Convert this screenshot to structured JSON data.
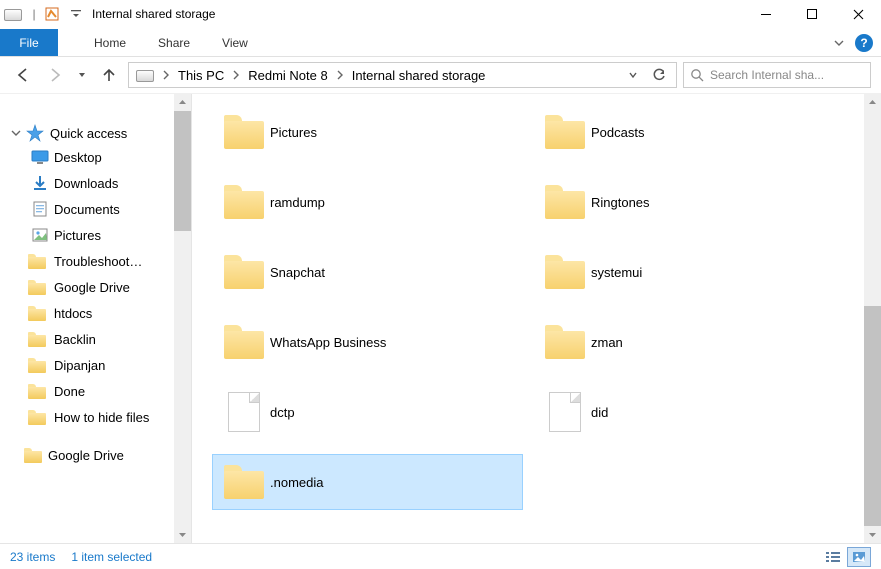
{
  "window": {
    "title": "Internal shared storage"
  },
  "ribbon": {
    "file": "File",
    "tabs": [
      "Home",
      "Share",
      "View"
    ]
  },
  "breadcrumb": {
    "segments": [
      "This PC",
      "Redmi Note 8",
      "Internal shared storage"
    ]
  },
  "search": {
    "placeholder": "Search Internal sha..."
  },
  "navpane": {
    "quick_access": "Quick access",
    "items": [
      {
        "label": "Desktop",
        "icon": "monitor",
        "pinned": true
      },
      {
        "label": "Downloads",
        "icon": "download",
        "pinned": true
      },
      {
        "label": "Documents",
        "icon": "document",
        "pinned": true
      },
      {
        "label": "Pictures",
        "icon": "pictures",
        "pinned": true
      },
      {
        "label": "Troubleshoot…",
        "icon": "folder",
        "pinned": true
      },
      {
        "label": "Google Drive",
        "icon": "folder",
        "pinned": true
      },
      {
        "label": "htdocs",
        "icon": "folder",
        "pinned": true
      },
      {
        "label": "Backlin",
        "icon": "folder",
        "pinned": true
      },
      {
        "label": "Dipanjan",
        "icon": "folder",
        "pinned": true
      },
      {
        "label": "Done",
        "icon": "folder",
        "pinned": true
      },
      {
        "label": "How to hide files",
        "icon": "folder",
        "pinned": true
      }
    ],
    "footer_item": "Google Drive"
  },
  "content": {
    "items": [
      {
        "name": "Pictures",
        "type": "folder"
      },
      {
        "name": "Podcasts",
        "type": "folder"
      },
      {
        "name": "ramdump",
        "type": "folder"
      },
      {
        "name": "Ringtones",
        "type": "folder"
      },
      {
        "name": "Snapchat",
        "type": "folder"
      },
      {
        "name": "systemui",
        "type": "folder"
      },
      {
        "name": "WhatsApp Business",
        "type": "folder"
      },
      {
        "name": "zman",
        "type": "folder"
      },
      {
        "name": "dctp",
        "type": "file"
      },
      {
        "name": "did",
        "type": "file"
      },
      {
        "name": ".nomedia",
        "type": "folder",
        "selected": true
      }
    ]
  },
  "status": {
    "count": "23 items",
    "selection": "1 item selected"
  }
}
